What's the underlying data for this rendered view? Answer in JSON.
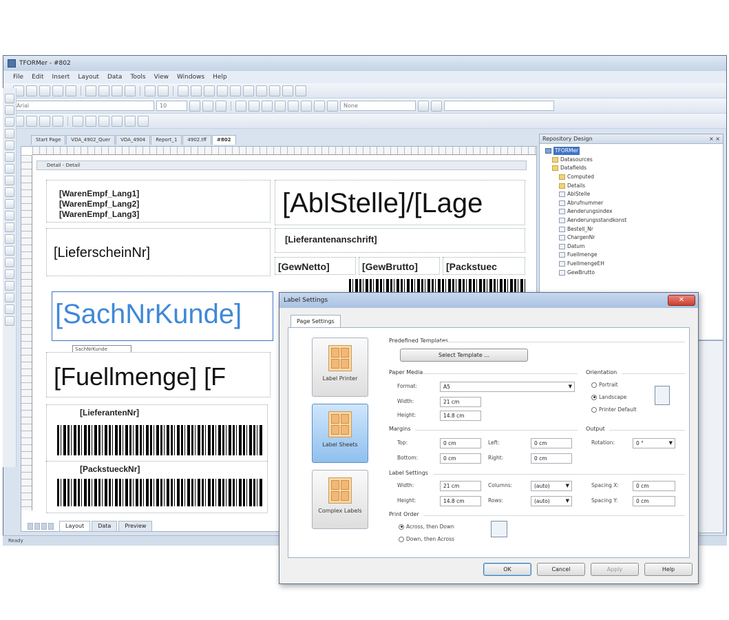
{
  "window": {
    "title": "TFORMer - #802"
  },
  "menu": [
    "File",
    "Edit",
    "Insert",
    "Layout",
    "Data",
    "Tools",
    "View",
    "Windows",
    "Help"
  ],
  "toolbar": {
    "font_combo": "Arial",
    "size_combo": "10",
    "style_combo": "None"
  },
  "doc_tabs": [
    "Start Page",
    "VDA_4902_Quer",
    "VDA_4904",
    "Report_1",
    "4902.tff",
    "#802"
  ],
  "designer": {
    "section": "Detail - Detail",
    "fields": {
      "waren_empf_1": "[WarenEmpf_Lang1]",
      "waren_empf_2": "[WarenEmpf_Lang2]",
      "waren_empf_3": "[WarenEmpf_Lang3]",
      "abl_stelle": "[AblStelle]/[Lage",
      "lieferanten_anschrift": "[Lieferantenanschrift]",
      "lieferschein_nr": "[LieferscheinNr]",
      "gew_netto": "[GewNetto]",
      "gew_brutto": "[GewBrutto]",
      "packstuec": "[Packstuec",
      "sach_nr_kunde": "[SachNrKunde]",
      "sach_nr_kunde_tag": "SachNrKunde",
      "fuellmenge": "[Fuellmenge] [F",
      "lieferanten_nr": "[LieferantenNr]",
      "packstueck_nr": "[PackstueckNr]"
    }
  },
  "bottom_tabs": [
    "Layout",
    "Data",
    "Preview"
  ],
  "status": "Ready",
  "repository": {
    "title": "Repository Design",
    "items": [
      {
        "label": "TFORMer",
        "icon": "db",
        "indent": 0,
        "selected": true
      },
      {
        "label": "Datasources",
        "icon": "folder",
        "indent": 1
      },
      {
        "label": "Datafields",
        "icon": "folder",
        "indent": 1
      },
      {
        "label": "Computed",
        "icon": "folder",
        "indent": 2
      },
      {
        "label": "Details",
        "icon": "folder",
        "indent": 2
      },
      {
        "label": "AblStelle",
        "icon": "field",
        "indent": 2
      },
      {
        "label": "Abrufnummer",
        "icon": "field",
        "indent": 2
      },
      {
        "label": "Aenderungsindex",
        "icon": "field",
        "indent": 2
      },
      {
        "label": "Aenderungsstandkonst",
        "icon": "field",
        "indent": 2
      },
      {
        "label": "Bestell_Nr",
        "icon": "field",
        "indent": 2
      },
      {
        "label": "ChargenNr",
        "icon": "field",
        "indent": 2
      },
      {
        "label": "Datum",
        "icon": "field",
        "indent": 2
      },
      {
        "label": "Fuellmenge",
        "icon": "field",
        "indent": 2
      },
      {
        "label": "FuellmengeEH",
        "icon": "field",
        "indent": 2
      },
      {
        "label": "GewBrutto",
        "icon": "field",
        "indent": 2
      }
    ]
  },
  "dialog": {
    "title": "Label Settings",
    "tab": "Page Settings",
    "types": [
      {
        "label": "Label Printer",
        "active": false
      },
      {
        "label": "Label Sheets",
        "active": true
      },
      {
        "label": "Complex Labels",
        "active": false
      }
    ],
    "predefined_templates": {
      "heading": "Predefined Templates",
      "button": "Select Template ..."
    },
    "paper_media": {
      "heading": "Paper Media",
      "format_label": "Format:",
      "format_value": "A5",
      "width_label": "Width:",
      "width_value": "21 cm",
      "height_label": "Height:",
      "height_value": "14.8 cm"
    },
    "orientation": {
      "heading": "Orientation",
      "options": [
        "Portrait",
        "Landscape",
        "Printer Default"
      ],
      "selected": "Landscape"
    },
    "margins": {
      "heading": "Margins",
      "top_label": "Top:",
      "top_value": "0 cm",
      "left_label": "Left:",
      "left_value": "0 cm",
      "bottom_label": "Bottom:",
      "bottom_value": "0 cm",
      "right_label": "Right:",
      "right_value": "0 cm"
    },
    "output": {
      "heading": "Output",
      "rotation_label": "Rotation:",
      "rotation_value": "0 °"
    },
    "label_settings": {
      "heading": "Label Settings",
      "width_label": "Width:",
      "width_value": "21 cm",
      "height_label": "Height:",
      "height_value": "14.8 cm",
      "columns_label": "Columns:",
      "columns_value": "(auto)",
      "rows_label": "Rows:",
      "rows_value": "(auto)",
      "spacing_x_label": "Spacing X:",
      "spacing_x_value": "0 cm",
      "spacing_y_label": "Spacing Y:",
      "spacing_y_value": "0 cm"
    },
    "print_order": {
      "heading": "Print Order",
      "options": [
        "Across, then Down",
        "Down, then Across"
      ],
      "selected": "Across, then Down"
    },
    "buttons": {
      "ok": "OK",
      "cancel": "Cancel",
      "apply": "Apply",
      "help": "Help"
    }
  }
}
